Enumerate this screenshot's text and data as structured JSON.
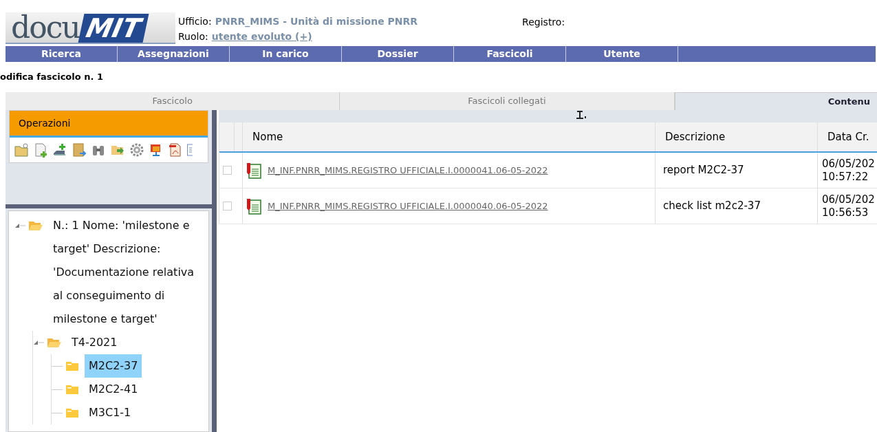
{
  "logo": {
    "part_1": "docu",
    "part_2": "MIT"
  },
  "header": {
    "office_label": "Ufficio:",
    "office_value": "PNRR_MIMS - Unità di missione PNRR",
    "role_label": "Ruolo:",
    "role_value": "utente evoluto (+)",
    "register_label": "Registro:"
  },
  "nav": [
    "Ricerca",
    "Assegnazioni",
    "In carico",
    "Dossier",
    "Fascicoli",
    "Utente"
  ],
  "page_title": "odifica fascicolo n. 1",
  "tabs": [
    {
      "label": "Fascicolo",
      "selected": false
    },
    {
      "label": "Fascicoli collegati",
      "selected": false
    },
    {
      "label": "Contenu",
      "selected": true
    }
  ],
  "operations": {
    "title": "Operazioni"
  },
  "tree": {
    "label": "N.: 1 Nome: 'milestone e target' Descrizione: 'Documentazione relativa al conseguimento di milestone e target'",
    "expanded": true,
    "selected": false,
    "children": [
      {
        "label": "T4-2021",
        "expanded": true,
        "selected": false,
        "children": [
          {
            "label": "M2C2-37",
            "selected": true
          },
          {
            "label": "M2C2-41",
            "selected": false
          },
          {
            "label": "M3C1-1",
            "selected": false
          }
        ]
      }
    ]
  },
  "table": {
    "columns": [
      "Nome",
      "Descrizione",
      "Data Cr."
    ],
    "rows": [
      {
        "checked": false,
        "name": "M_INF.PNRR_MIMS.REGISTRO UFFICIALE.I.0000041.06-05-2022",
        "description": "report M2C2-37",
        "date": "06/05/202",
        "time": "10:57:22"
      },
      {
        "checked": false,
        "name": "M_INF.PNRR_MIMS.REGISTRO UFFICIALE.I.0000040.06-05-2022",
        "description": "check list m2c2-37",
        "date": "06/05/202",
        "time": "10:56:53"
      }
    ]
  }
}
